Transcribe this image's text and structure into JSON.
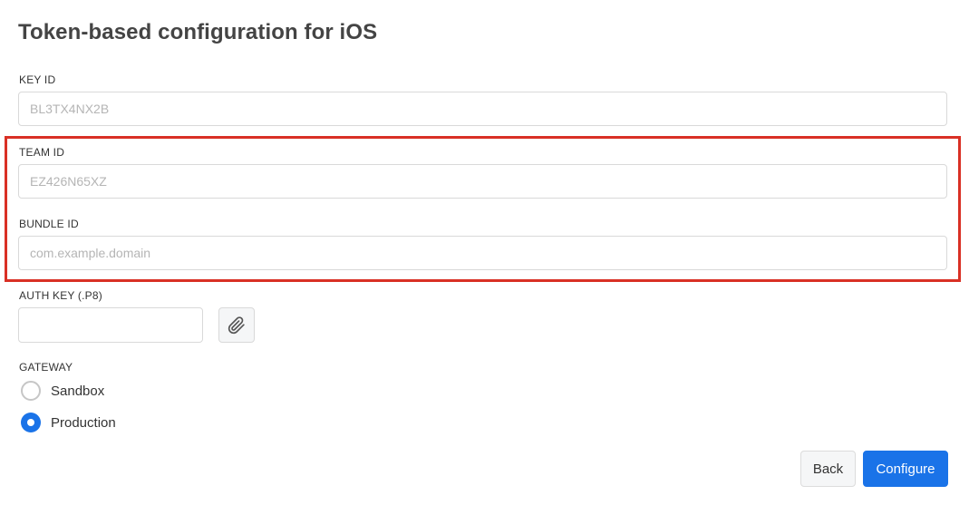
{
  "page": {
    "title": "Token-based configuration for iOS"
  },
  "form": {
    "key_id": {
      "label": "KEY ID",
      "value": "",
      "placeholder": "BL3TX4NX2B"
    },
    "team_id": {
      "label": "TEAM ID",
      "value": "",
      "placeholder": "EZ426N65XZ"
    },
    "bundle_id": {
      "label": "BUNDLE ID",
      "value": "",
      "placeholder": "com.example.domain"
    },
    "auth_key": {
      "label": "AUTH KEY (.P8)",
      "value": "",
      "attach_icon": "paperclip-icon"
    },
    "gateway": {
      "label": "GATEWAY",
      "options": [
        {
          "label": "Sandbox",
          "selected": false
        },
        {
          "label": "Production",
          "selected": true
        }
      ]
    }
  },
  "actions": {
    "back_label": "Back",
    "configure_label": "Configure"
  },
  "colors": {
    "primary": "#1a73e8",
    "highlight_border": "#d93025"
  }
}
